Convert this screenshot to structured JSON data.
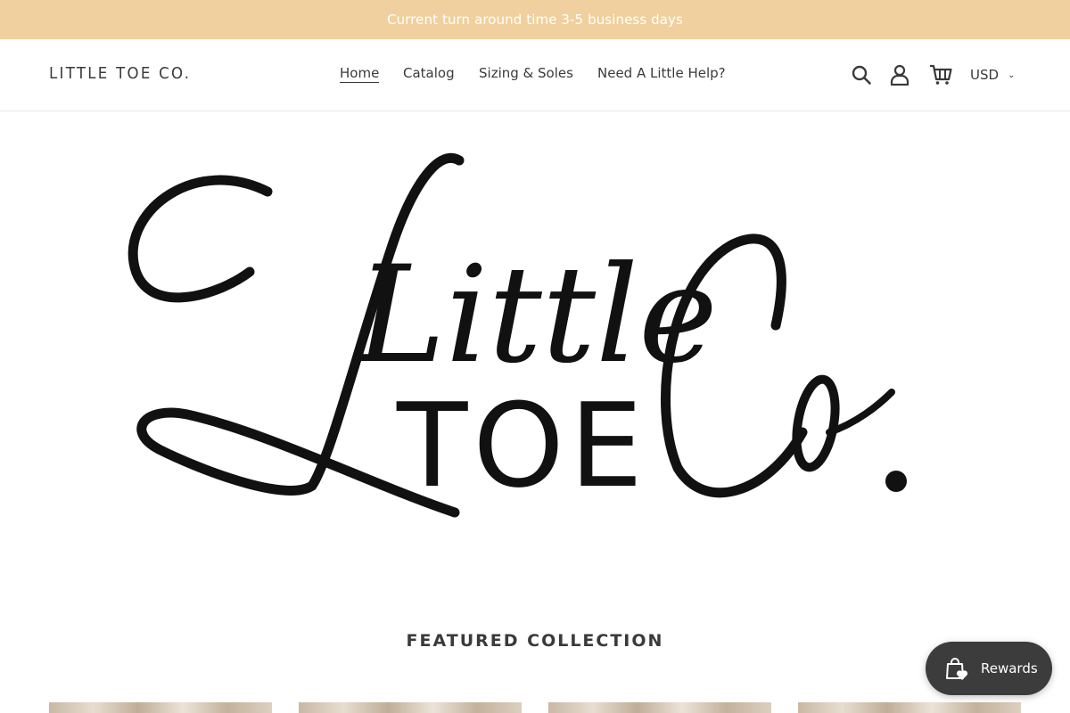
{
  "announcement": {
    "text": "Current turn around time 3-5 business days"
  },
  "header": {
    "brand": "LITTLE TOE CO.",
    "nav": [
      {
        "label": "Home",
        "active": true
      },
      {
        "label": "Catalog"
      },
      {
        "label": "Sizing & Soles"
      },
      {
        "label": "Need A Little Help?"
      }
    ],
    "icons": [
      "search-icon",
      "account-icon",
      "cart-icon"
    ],
    "currency": {
      "selected": "USD"
    }
  },
  "hero": {
    "logo_text_script_line1": "Little",
    "logo_text_caps": "TOE",
    "logo_text_script_line2": "Co."
  },
  "featured": {
    "title": "FEATURED COLLECTION"
  },
  "rewards": {
    "label": "Rewards"
  },
  "colors": {
    "announcement_bg": "#efd09e",
    "rewards_bg": "#3c3c3c",
    "text": "#3a3a3a"
  }
}
